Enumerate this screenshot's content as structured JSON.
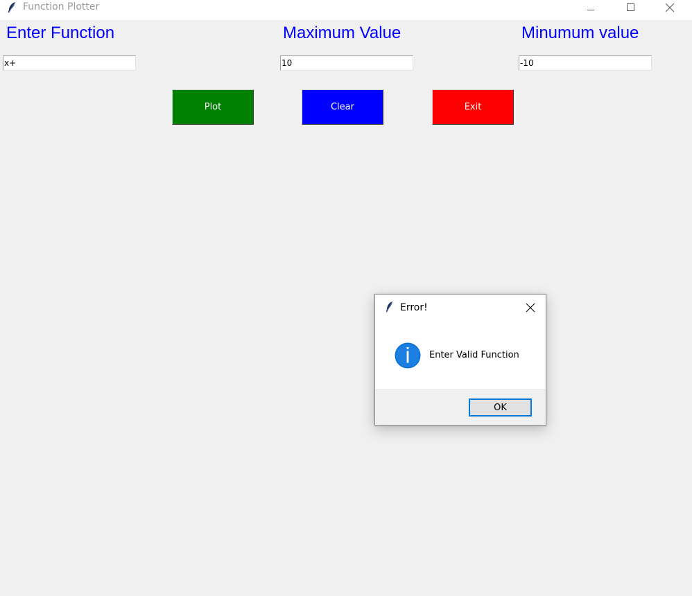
{
  "window": {
    "title": "Function Plotter",
    "icon": "feather-icon",
    "controls": [
      "minimize-icon",
      "maximize-icon",
      "close-icon"
    ]
  },
  "form": {
    "function_label": "Enter Function",
    "max_label": "Maximum Value",
    "min_label": "Minumum value",
    "function_value": "x+",
    "max_value": "10",
    "min_value": "-10",
    "label_color": "#0000ff"
  },
  "buttons": {
    "plot": {
      "label": "Plot",
      "color": "#008000"
    },
    "clear": {
      "label": "Clear",
      "color": "#0000ff"
    },
    "exit": {
      "label": "Exit",
      "color": "#ff0000"
    }
  },
  "dialog": {
    "title": "Error!",
    "icon": "info-icon",
    "message": "Enter Valid Function",
    "ok_label": "OK"
  }
}
